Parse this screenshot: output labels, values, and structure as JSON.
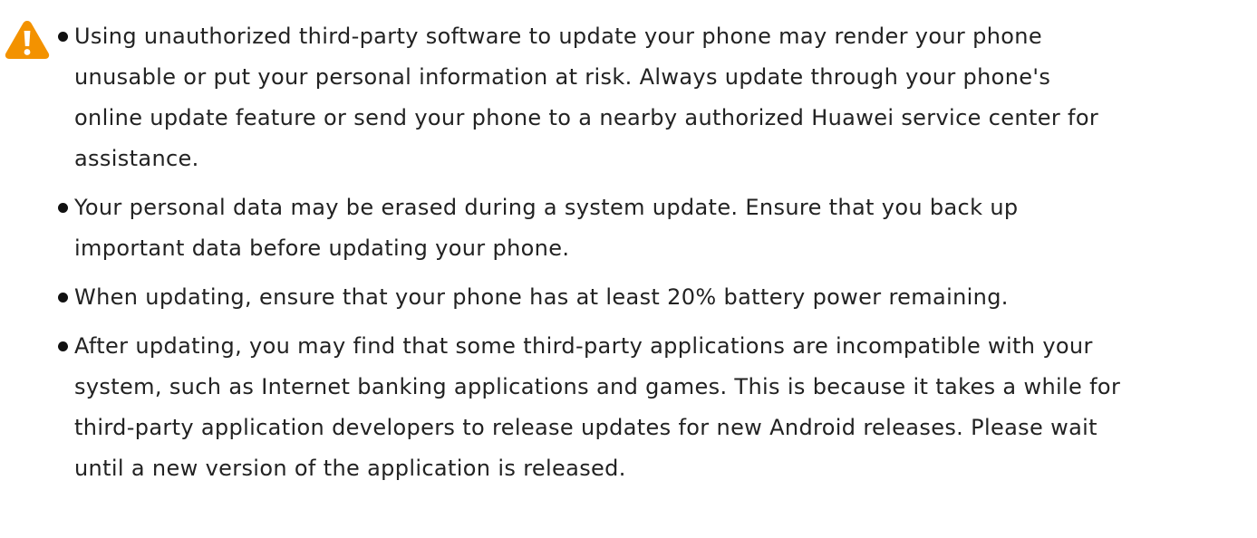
{
  "notice": {
    "icon": "warning-triangle-icon",
    "icon_color": "#F39200",
    "items": [
      {
        "text": "Using unauthorized third-party software to update your phone may render your phone\nunusable or put your personal information at risk. Always update through your phone's\nonline update feature or send your phone to a nearby authorized Huawei service center for\nassistance."
      },
      {
        "text": "Your personal data may be erased during a system update. Ensure that you back up\nimportant data before updating your phone."
      },
      {
        "text": "When updating, ensure that your phone has at least 20% battery power remaining."
      },
      {
        "text": "After updating, you may find that some third-party applications are incompatible with your\nsystem, such as Internet banking applications and games. This is because it takes a while for\nthird-party application developers to release updates for new Android releases. Please wait\nuntil a new version of the application is released."
      }
    ]
  }
}
